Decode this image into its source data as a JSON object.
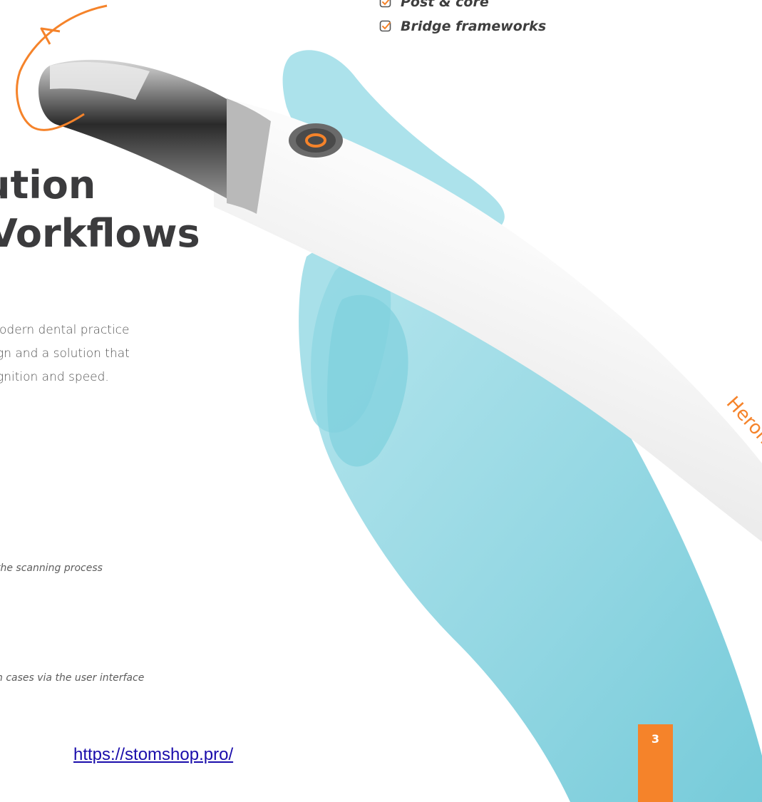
{
  "features": [
    {
      "label": "Post & core",
      "icon": "checkbox-checked-icon"
    },
    {
      "label": "Bridge frameworks",
      "icon": "checkbox-checked-icon"
    }
  ],
  "heading": {
    "line1": "ution",
    "line2": "Vorkflows"
  },
  "intro": [
    "odern dental practice",
    "gn and a solution that",
    "gnition and speed."
  ],
  "notes": [
    "the scanning process",
    "n cases via the user interface"
  ],
  "scanner_brand": "Heron",
  "link": "https://stomshop.pro/",
  "page_number": "3",
  "colors": {
    "accent": "#f5832a",
    "heading": "#3b3b3d",
    "glove": "#8fd6e0",
    "link": "#1a0dab"
  },
  "icons": [
    "rotate-arrow-icon",
    "scanner-button-icon",
    "checkbox-checked-icon"
  ]
}
